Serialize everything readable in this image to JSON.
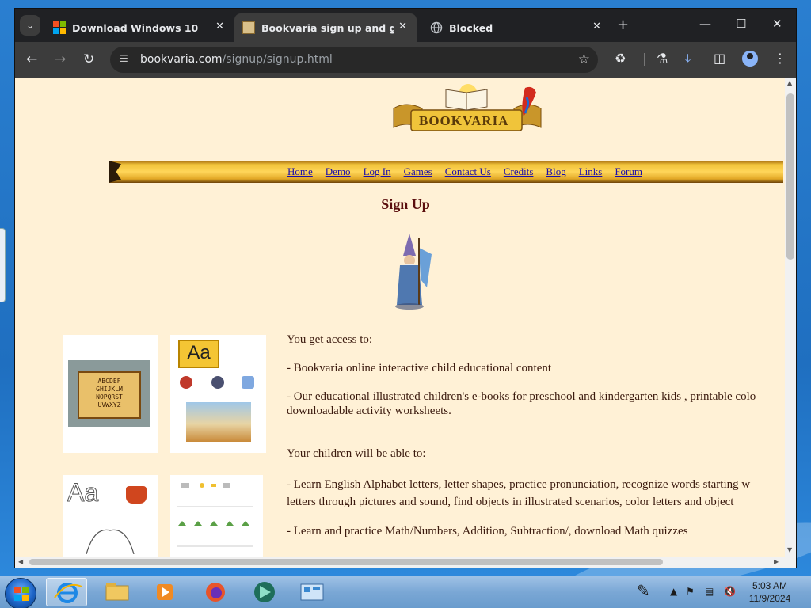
{
  "browser": {
    "tabs": [
      {
        "title": "Download Windows 10",
        "favicon": "windows-logo-icon",
        "active": false
      },
      {
        "title": "Bookvaria sign up and get acce",
        "favicon": "bookvaria-favicon-icon",
        "active": true
      },
      {
        "title": "Blocked",
        "favicon": "globe-icon",
        "active": false
      }
    ],
    "url_host": "bookvaria.com",
    "url_path": "/signup/signup.html"
  },
  "page": {
    "logo_text": "BOOKVARIA",
    "nav_links": [
      "Home",
      "Demo",
      "Log In",
      "Games",
      "Contact Us",
      "Credits",
      "Blog",
      "Links",
      "Forum"
    ],
    "heading": "Sign Up",
    "access_title": "You get access to:",
    "access_items": [
      "- Bookvaria online interactive child educational content",
      "- Our educational illustrated children's e-books for preschool and kindergarten kids , printable colo",
      "downloadable activity worksheets."
    ],
    "children_title": "Your children will be able to:",
    "children_items": [
      "- Learn English Alphabet letters, letter shapes, practice pronunciation, recognize words starting w",
      "letters through pictures and sound, find objects in illustrated scenarios, color letters and object",
      "- Learn and practice Math/Numbers, Addition, Subtraction/, download Math quizzes"
    ],
    "thumb_alphabet": [
      "ABCDEF",
      "GHIJKLM",
      "NOPQRST",
      "UVWXYZ"
    ],
    "thumb_letters": "Aa",
    "thumb_letters_outline": "Aa"
  },
  "taskbar": {
    "time": "5:03 AM",
    "date": "11/9/2024"
  },
  "colors": {
    "page_bg": "#fff1d6",
    "link": "#1a0dab",
    "heading": "#5a0e0e",
    "body_text": "#3b1a0e"
  }
}
